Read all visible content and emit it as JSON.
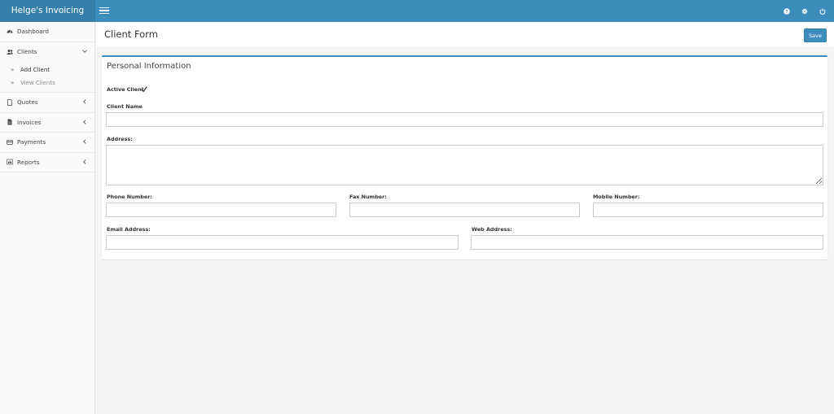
{
  "header": {
    "brand": "Helge's Invoicing",
    "icons": [
      "question-icon",
      "gear-icon",
      "power-icon"
    ]
  },
  "sidebar": {
    "items": [
      {
        "label": "Dashboard",
        "icon": "dashboard-icon"
      },
      {
        "label": "Clients",
        "icon": "users-icon",
        "open": true,
        "children": [
          {
            "label": "Add Client",
            "active": true
          },
          {
            "label": "View Clients",
            "active": false
          }
        ]
      },
      {
        "label": "Quotes",
        "icon": "file-icon"
      },
      {
        "label": "Invoices",
        "icon": "file-text-icon"
      },
      {
        "label": "Payments",
        "icon": "credit-card-icon"
      },
      {
        "label": "Reports",
        "icon": "bar-chart-icon"
      }
    ]
  },
  "content": {
    "title": "Client Form",
    "save_label": "Save"
  },
  "form": {
    "section_title": "Personal Information",
    "active_client_label": "Active Client",
    "active_client_checked": true,
    "client_name_label": "Client Name",
    "client_name_value": "",
    "address_label": "Address:",
    "address_value": "",
    "phone_label": "Phone Number:",
    "phone_value": "",
    "fax_label": "Fax Number:",
    "fax_value": "",
    "mobile_label": "Mobile Number:",
    "mobile_value": "",
    "email_label": "Email Address:",
    "email_value": "",
    "web_label": "Web Address:",
    "web_value": ""
  },
  "colors": {
    "primary": "#3c8dbc",
    "brand_bg": "#367fa9",
    "sidebar_bg": "#f9fafc",
    "page_bg": "#f4f4f4"
  }
}
